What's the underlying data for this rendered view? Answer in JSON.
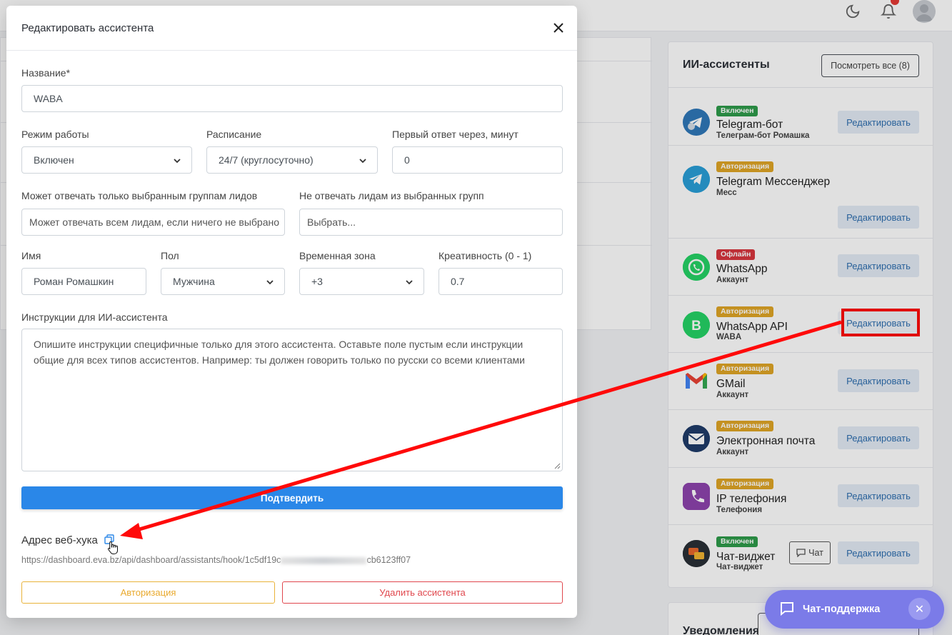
{
  "modal": {
    "title": "Редактировать ассистента",
    "name_label": "Название*",
    "name_value": "WABA",
    "mode_label": "Режим работы",
    "mode_value": "Включен",
    "schedule_label": "Расписание",
    "schedule_value": "24/7 (круглосуточно)",
    "first_reply_label": "Первый ответ через, минут",
    "first_reply_value": "0",
    "only_groups_label": "Может отвечать только выбранным группам лидов",
    "only_groups_placeholder": "Может отвечать всем лидам, если ничего не выбрано",
    "exclude_groups_label": "Не отвечать лидам из выбранных групп",
    "exclude_groups_placeholder": "Выбрать...",
    "person_name_label": "Имя",
    "person_name_value": "Роман Ромашкин",
    "gender_label": "Пол",
    "gender_value": "Мужчина",
    "timezone_label": "Временная зона",
    "timezone_value": "+3",
    "creativity_label": "Креативность (0 - 1)",
    "creativity_value": "0.7",
    "instructions_label": "Инструкции для ИИ-ассистента",
    "instructions_placeholder": "Опишите инструкции специфичные только для этого ассистента. Оставьте поле пустым если инструкции общие для всех типов ассистентов. Например: ты должен говорить только по русски со всеми клиентами",
    "confirm_label": "Подтвердить",
    "webhook_label": "Адрес веб-хука",
    "webhook_url_start": "https://dashboard.eva.bz/api/dashboard/assistants/hook/1c5df19c",
    "webhook_url_end": "cb6123ff07",
    "auth_label": "Авторизация",
    "delete_label": "Удалить ассистента"
  },
  "panel": {
    "title": "ИИ-ассистенты",
    "view_all_label": "Посмотреть все (8)",
    "edit_label": "Редактировать",
    "chat_label": "Чат",
    "assistants": [
      {
        "name": "Telegram-бот",
        "sub": "Телеграм-бот Ромашка",
        "status": "Включен",
        "icon": "telegram-bot-icon"
      },
      {
        "name": "Telegram Мессенджер",
        "sub": "Месс",
        "status": "Авторизация",
        "icon": "telegram-icon"
      },
      {
        "name": "WhatsApp",
        "sub": "Аккаунт",
        "status": "Офлайн",
        "icon": "whatsapp-icon"
      },
      {
        "name": "WhatsApp API",
        "sub": "WABA",
        "status": "Авторизация",
        "icon": "whatsapp-business-icon"
      },
      {
        "name": "GMail",
        "sub": "Аккаунт",
        "status": "Авторизация",
        "icon": "gmail-icon"
      },
      {
        "name": "Электронная почта",
        "sub": "Аккаунт",
        "status": "Авторизация",
        "icon": "email-icon"
      },
      {
        "name": "IP телефония",
        "sub": "Телефония",
        "status": "Авторизация",
        "icon": "phone-icon"
      },
      {
        "name": "Чат-виджет",
        "sub": "Чат-виджет",
        "status": "Включен",
        "icon": "chat-widget-icon"
      }
    ]
  },
  "notifications": {
    "title": "Уведомления"
  },
  "support": {
    "label": "Чат-поддержка"
  },
  "colors": {
    "accent": "#2a87e8",
    "status_on": "#2e9b4a",
    "status_auth": "#e0a526",
    "status_off": "#d9363e",
    "highlight": "#ff0a0a",
    "support": "#7b7be8"
  }
}
